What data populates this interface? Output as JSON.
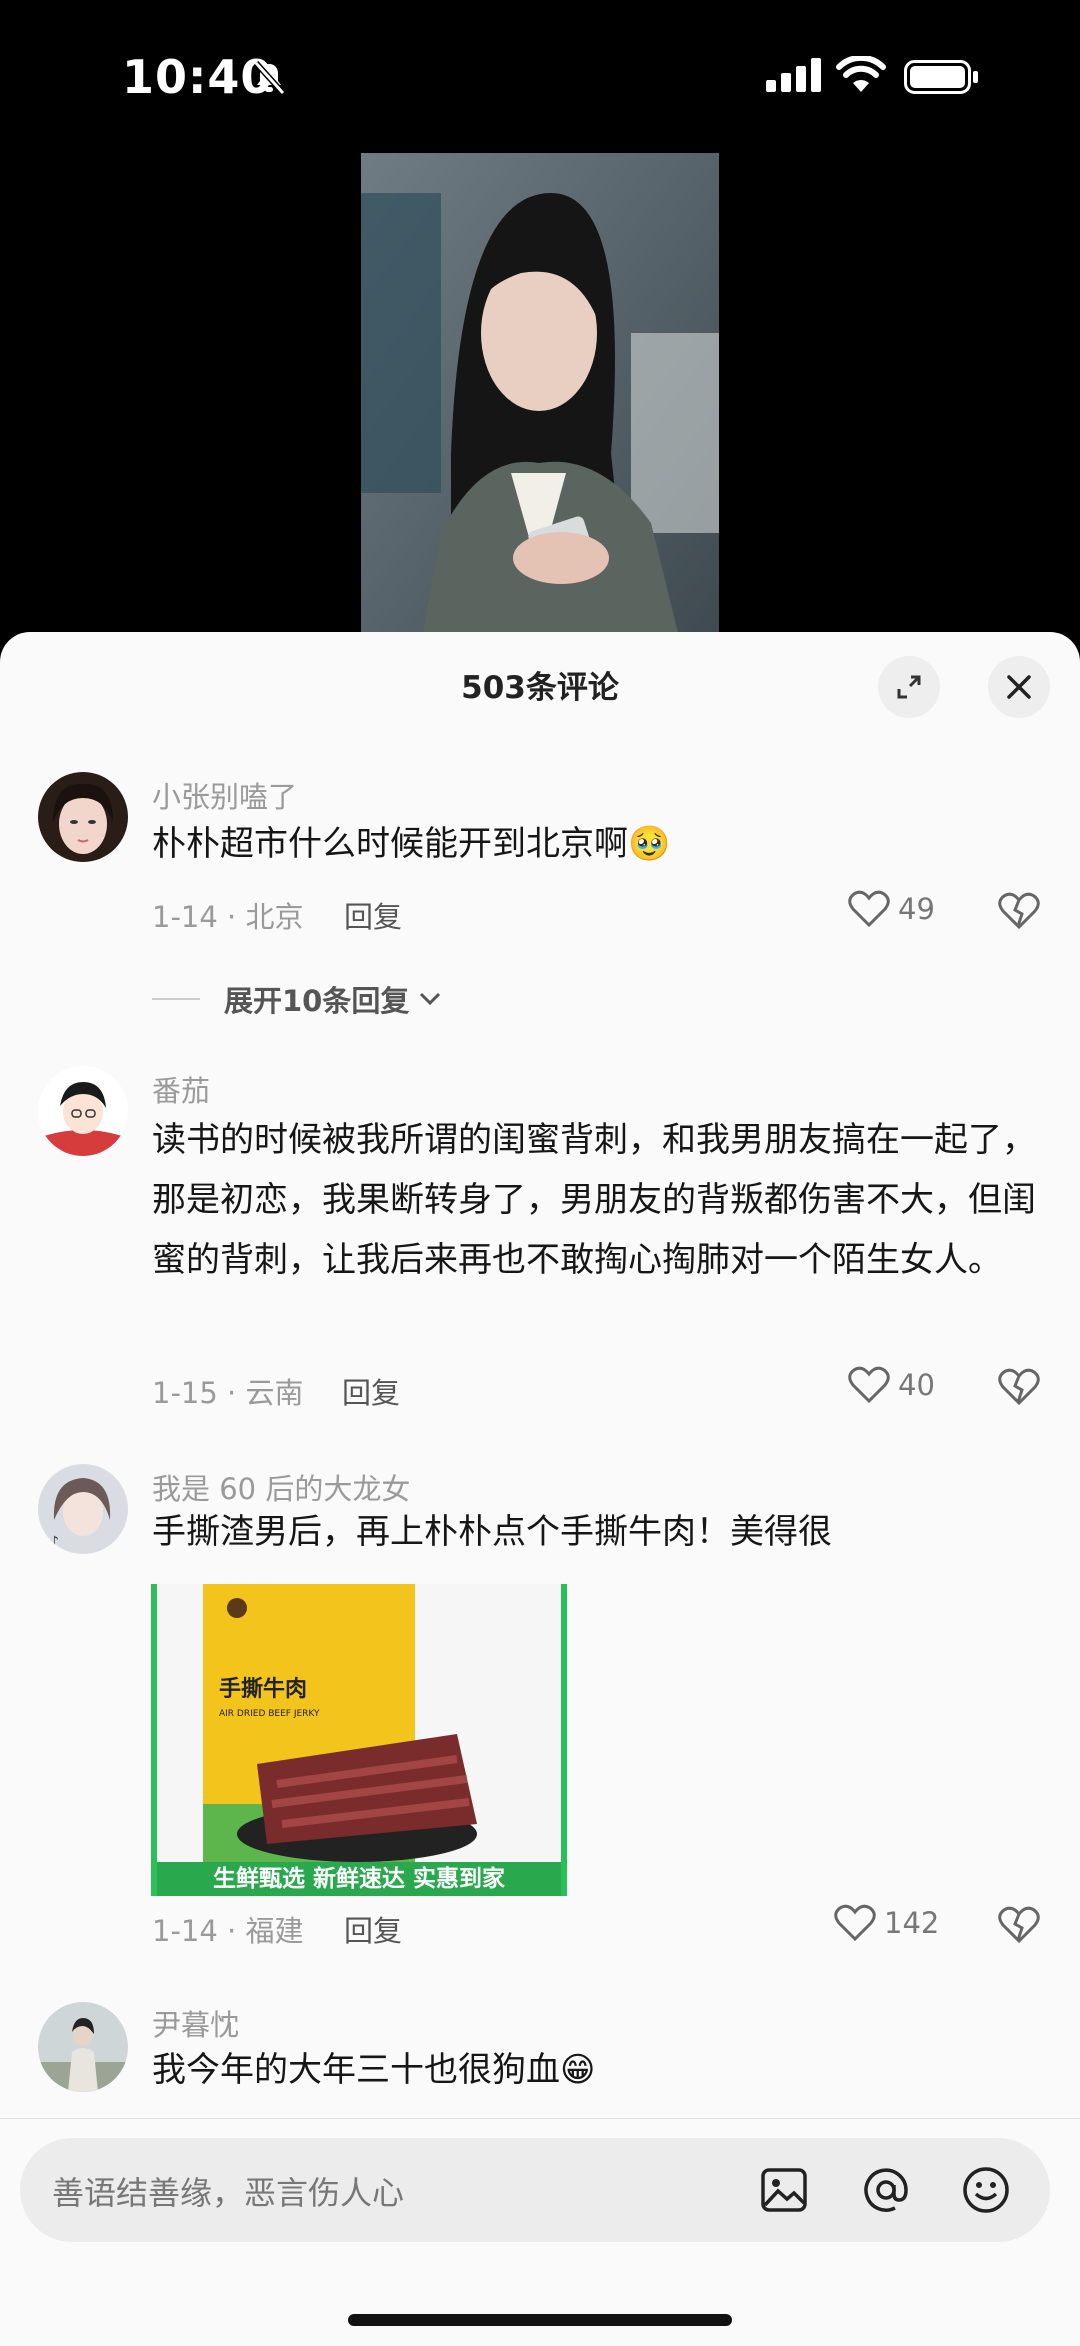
{
  "status_bar": {
    "time": "10:40"
  },
  "sheet": {
    "title": "503条评论"
  },
  "comments": [
    {
      "user": "小张别嗑了",
      "text": "朴朴超市什么时候能开到北京啊🥹",
      "date_loc": "1-14 · 北京",
      "reply": "回复",
      "likes": "49"
    },
    {
      "user": "番茄",
      "text": "读书的时候被我所谓的闺蜜背刺，和我男朋友搞在一起了，那是初恋，我果断转身了，男朋友的背叛都伤害不大，但闺蜜的背刺，让我后来再也不敢掏心掏肺对一个陌生女人。",
      "date_loc": "1-15 · 云南",
      "reply": "回复",
      "likes": "40"
    },
    {
      "user": "我是 60 后的大龙女",
      "text": "手撕渣男后，再上朴朴点个手撕牛肉！美得很",
      "date_loc": "1-14 · 福建",
      "reply": "回复",
      "likes": "142",
      "product": {
        "name": "手撕牛肉",
        "sub": "AIR DRIED BEEF JERKY",
        "banner": "生鲜甄选 新鲜速达 实惠到家"
      }
    },
    {
      "user": "尹暮忱",
      "text": "我今年的大年三十也很狗血😁"
    }
  ],
  "expand_replies": "展开10条回复",
  "input": {
    "placeholder": "善语结善缘，恶言伤人心"
  },
  "colors": {
    "accent_green": "#2bbf5a",
    "background": "#fafafa"
  }
}
